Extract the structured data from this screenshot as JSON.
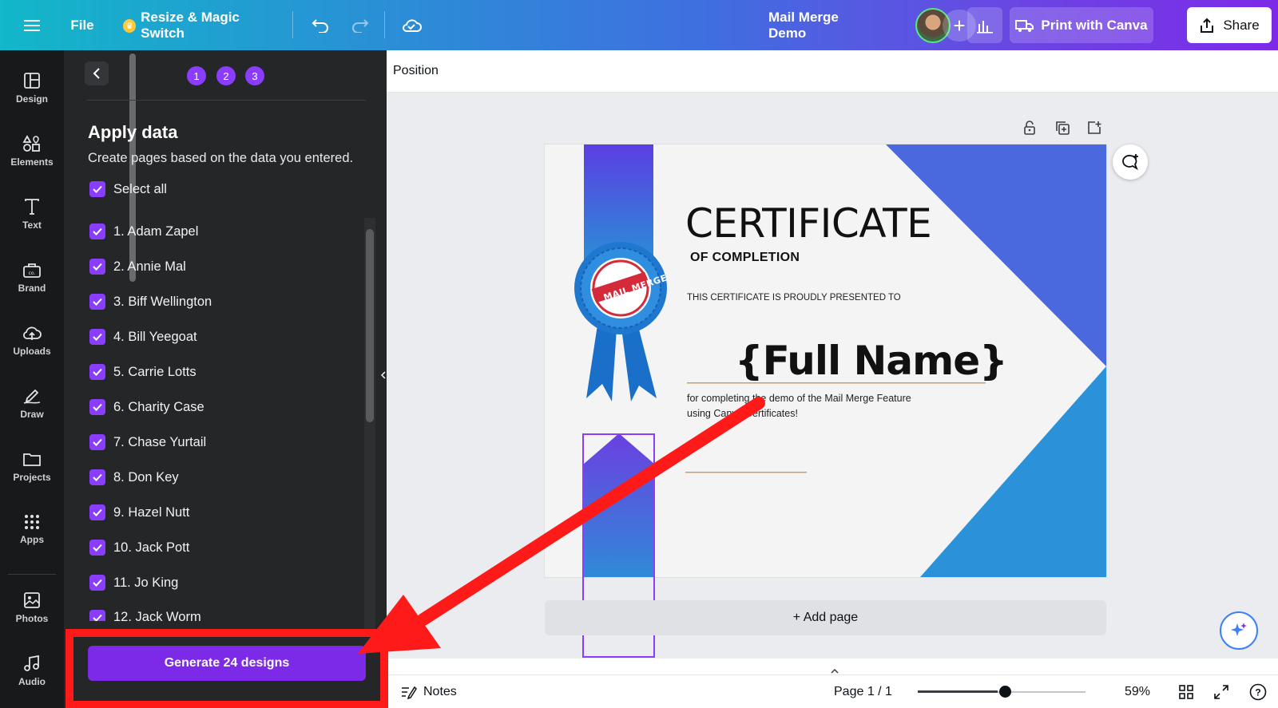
{
  "topbar": {
    "file": "File",
    "resize": "Resize & Magic Switch",
    "title": "Mail Merge Demo",
    "print": "Print with Canva",
    "share": "Share"
  },
  "rail": [
    {
      "label": "Design",
      "icon": "design-icon"
    },
    {
      "label": "Elements",
      "icon": "elements-icon"
    },
    {
      "label": "Text",
      "icon": "text-icon"
    },
    {
      "label": "Brand",
      "icon": "brand-icon"
    },
    {
      "label": "Uploads",
      "icon": "uploads-icon"
    },
    {
      "label": "Draw",
      "icon": "draw-icon"
    },
    {
      "label": "Projects",
      "icon": "projects-icon"
    },
    {
      "label": "Apps",
      "icon": "apps-icon"
    },
    {
      "label": "Photos",
      "icon": "photos-icon"
    },
    {
      "label": "Audio",
      "icon": "audio-icon"
    }
  ],
  "panel": {
    "steps": [
      "1",
      "2",
      "3"
    ],
    "title": "Apply data",
    "subtitle": "Create pages based on the data you entered.",
    "select_all": "Select all",
    "rows": [
      "1. Adam Zapel",
      "2. Annie Mal",
      "3. Biff Wellington",
      "4. Bill Yeegoat",
      "5. Carrie Lotts",
      "6. Charity Case",
      "7. Chase Yurtail",
      "8. Don Key",
      "9. Hazel Nutt",
      "10. Jack Pott",
      "11. Jo King",
      "12. Jack Worm"
    ],
    "generate": "Generate 24 designs"
  },
  "editor": {
    "position": "Position",
    "add_page": "+ Add page"
  },
  "certificate": {
    "title": "CERTIFICATE",
    "subtitle": "OF COMPLETION",
    "presented": "THIS CERTIFICATE IS PROUDLY PRESENTED TO",
    "name": "{Full Name}",
    "desc1": "for completing the demo of the Mail Merge Feature",
    "desc2": "using Canva Certificates!",
    "seal": "MAIL MERGE"
  },
  "bottombar": {
    "notes": "Notes",
    "page": "Page 1 / 1",
    "zoom": "59%",
    "zoom_level": 0.48
  },
  "colors": {
    "accent": "#8b3dff",
    "annotation": "#ff1a1a"
  }
}
